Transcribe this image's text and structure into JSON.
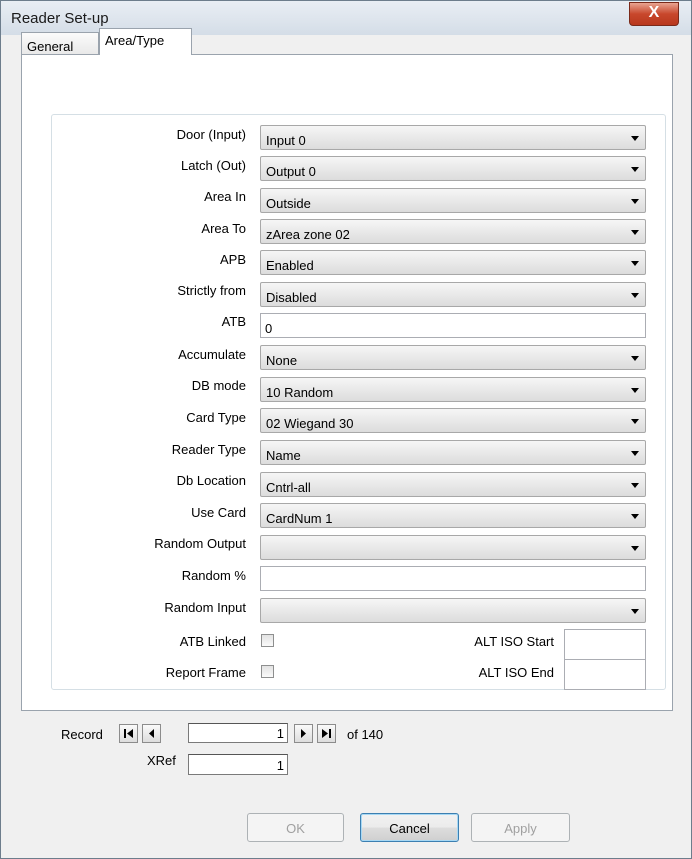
{
  "window": {
    "title": "Reader Set-up",
    "close_label": "X"
  },
  "tabs": [
    {
      "label": "General"
    },
    {
      "label": "Area/Type"
    }
  ],
  "fields": {
    "door_input": {
      "label": "Door (Input)",
      "value": "Input 0"
    },
    "latch_out": {
      "label": "Latch (Out)",
      "value": "Output 0"
    },
    "area_in": {
      "label": "Area In",
      "value": "Outside"
    },
    "area_to": {
      "label": "Area To",
      "value": "zArea zone 02"
    },
    "apb": {
      "label": "APB",
      "value": "Enabled"
    },
    "strictly_from": {
      "label": "Strictly from",
      "value": "Disabled"
    },
    "atb": {
      "label": "ATB",
      "value": "0"
    },
    "accumulate": {
      "label": "Accumulate",
      "value": "None"
    },
    "db_mode": {
      "label": "DB mode",
      "value": "10 Random"
    },
    "card_type": {
      "label": "Card Type",
      "value": "02 Wiegand 30"
    },
    "reader_type": {
      "label": "Reader Type",
      "value": "Name"
    },
    "db_location": {
      "label": "Db Location",
      "value": "Cntrl-all"
    },
    "use_card": {
      "label": "Use Card",
      "value": "CardNum 1"
    },
    "random_output": {
      "label": "Random Output",
      "value": ""
    },
    "random_pct": {
      "label": "Random %",
      "value": ""
    },
    "random_input": {
      "label": "Random Input",
      "value": ""
    },
    "atb_linked": {
      "label": "ATB Linked",
      "checked": false
    },
    "report_frame": {
      "label": "Report Frame",
      "checked": false
    },
    "alt_iso_start": {
      "label": "ALT ISO Start",
      "value": ""
    },
    "alt_iso_end": {
      "label": "ALT ISO End",
      "value": ""
    }
  },
  "record_nav": {
    "label": "Record",
    "current": "1",
    "total_label": "of 140",
    "xref_label": "XRef",
    "xref_value": "1"
  },
  "buttons": {
    "ok": "OK",
    "cancel": "Cancel",
    "apply": "Apply"
  }
}
